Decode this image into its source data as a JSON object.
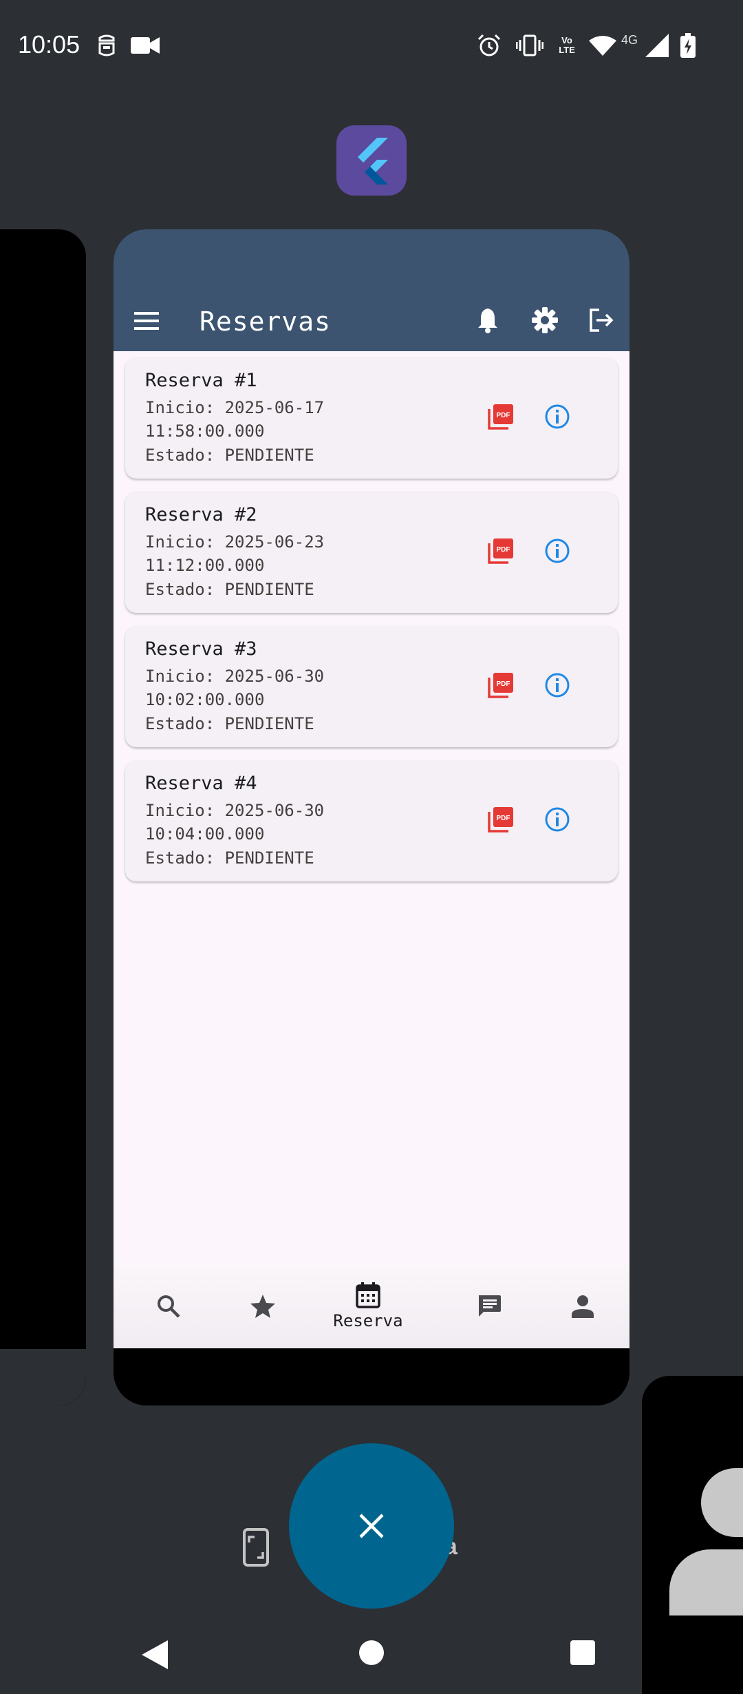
{
  "status_bar": {
    "time": "10:05",
    "network_label": "4G",
    "icons": [
      "authenticator-icon",
      "video-camera-icon",
      "alarm-icon",
      "vibrate-icon",
      "volte-icon",
      "wifi-icon",
      "signal-icon",
      "battery-charging-icon"
    ]
  },
  "launcher": {
    "app_icon": "flutter-app-icon",
    "screenshot_label": "ntalla"
  },
  "app": {
    "title": "Reservas",
    "header_icons": [
      "menu-icon",
      "bell-icon",
      "gear-icon",
      "logout-icon"
    ],
    "reservations": [
      {
        "title": "Reserva #1",
        "start": "Inicio: 2025-06-17",
        "time": "11:58:00.000",
        "status": "Estado: PENDIENTE"
      },
      {
        "title": "Reserva #2",
        "start": "Inicio: 2025-06-23",
        "time": "11:12:00.000",
        "status": "Estado: PENDIENTE"
      },
      {
        "title": "Reserva #3",
        "start": "Inicio: 2025-06-30",
        "time": "10:02:00.000",
        "status": "Estado: PENDIENTE"
      },
      {
        "title": "Reserva #4",
        "start": "Inicio: 2025-06-30",
        "time": "10:04:00.000",
        "status": "Estado: PENDIENTE"
      }
    ],
    "bottom_nav": {
      "items": [
        "search-icon",
        "star-icon",
        "calendar-icon",
        "chat-icon",
        "person-icon"
      ],
      "active_label": "Reserva"
    }
  },
  "colors": {
    "header": "#3c5470",
    "pdf": "#e53935",
    "info": "#1e88e5",
    "close_fab": "#00658f"
  }
}
